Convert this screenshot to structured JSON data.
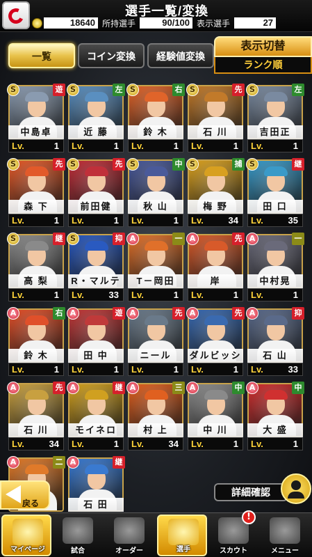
{
  "header": {
    "title": "選手一覧/変換",
    "coins": "18640",
    "owned_label": "所持選手",
    "owned_value": "90/100",
    "shown_label": "表示選手",
    "shown_value": "27"
  },
  "tabs": {
    "list": "一覧",
    "coin_convert": "コイン変換",
    "exp_convert": "経験値変換"
  },
  "sort": {
    "title": "表示切替",
    "value": "ランク順"
  },
  "players": [
    {
      "name": "中島卓",
      "lv": "1",
      "rank": "S",
      "pos": "遊",
      "pos_color": "red",
      "theme": "#8a9bb0"
    },
    {
      "name": "近 藤",
      "lv": "1",
      "rank": "S",
      "pos": "左",
      "pos_color": "green",
      "theme": "#5a8fc0"
    },
    {
      "name": "鈴 木",
      "lv": "1",
      "rank": "S",
      "pos": "右",
      "pos_color": "green",
      "theme": "#e0642a"
    },
    {
      "name": "石 川",
      "lv": "1",
      "rank": "S",
      "pos": "先",
      "pos_color": "red",
      "theme": "#c27a2a"
    },
    {
      "name": "吉田正",
      "lv": "1",
      "rank": "S",
      "pos": "左",
      "pos_color": "green",
      "theme": "#7a8aa0"
    },
    {
      "name": "森 下",
      "lv": "1",
      "rank": "S",
      "pos": "先",
      "pos_color": "red",
      "theme": "#e25a2a"
    },
    {
      "name": "前田健",
      "lv": "1",
      "rank": "S",
      "pos": "先",
      "pos_color": "red",
      "theme": "#c0303a"
    },
    {
      "name": "秋 山",
      "lv": "1",
      "rank": "S",
      "pos": "中",
      "pos_color": "green",
      "theme": "#4a5a9a"
    },
    {
      "name": "梅 野",
      "lv": "34",
      "rank": "S",
      "pos": "捕",
      "pos_color": "green",
      "theme": "#d8a020"
    },
    {
      "name": "田 口",
      "lv": "35",
      "rank": "S",
      "pos": "継",
      "pos_color": "red",
      "theme": "#3a9ac8"
    },
    {
      "name": "高 梨",
      "lv": "1",
      "rank": "S",
      "pos": "継",
      "pos_color": "red",
      "theme": "#8a8a8a"
    },
    {
      "name": "R・マルティネス",
      "lv": "33",
      "rank": "S",
      "pos": "抑",
      "pos_color": "red",
      "theme": "#2a5ac0"
    },
    {
      "name": "T－岡田",
      "lv": "1",
      "rank": "A",
      "pos": "一",
      "pos_color": "olive",
      "theme": "#e0702a"
    },
    {
      "name": "岸",
      "lv": "1",
      "rank": "A",
      "pos": "先",
      "pos_color": "red",
      "theme": "#d85a2a"
    },
    {
      "name": "中村晃",
      "lv": "1",
      "rank": "A",
      "pos": "一",
      "pos_color": "olive",
      "theme": "#6a6a7a"
    },
    {
      "name": "鈴 木",
      "lv": "1",
      "rank": "A",
      "pos": "右",
      "pos_color": "green",
      "theme": "#e0502a"
    },
    {
      "name": "田 中",
      "lv": "1",
      "rank": "A",
      "pos": "遊",
      "pos_color": "red",
      "theme": "#c03a3a"
    },
    {
      "name": "ニール",
      "lv": "1",
      "rank": "A",
      "pos": "先",
      "pos_color": "red",
      "theme": "#6a7a8a"
    },
    {
      "name": "ダルビッシュ",
      "lv": "1",
      "rank": "A",
      "pos": "先",
      "pos_color": "red",
      "theme": "#3a6ab0"
    },
    {
      "name": "石 山",
      "lv": "33",
      "rank": "A",
      "pos": "抑",
      "pos_color": "red",
      "theme": "#5a6a8a"
    },
    {
      "name": "石 川",
      "lv": "34",
      "rank": "A",
      "pos": "先",
      "pos_color": "red",
      "theme": "#c8a040"
    },
    {
      "name": "モイネロ",
      "lv": "1",
      "rank": "A",
      "pos": "継",
      "pos_color": "red",
      "theme": "#d0a020"
    },
    {
      "name": "村 上",
      "lv": "34",
      "rank": "A",
      "pos": "三",
      "pos_color": "olive",
      "theme": "#e06020"
    },
    {
      "name": "中 川",
      "lv": "1",
      "rank": "A",
      "pos": "中",
      "pos_color": "green",
      "theme": "#8a8a8a"
    },
    {
      "name": "大 盛",
      "lv": "1",
      "rank": "A",
      "pos": "中",
      "pos_color": "green",
      "theme": "#d03030"
    },
    {
      "name": "",
      "lv": "",
      "rank": "A",
      "pos": "二",
      "pos_color": "olive",
      "theme": "#e07a2a"
    },
    {
      "name": "石 田",
      "lv": "",
      "rank": "A",
      "pos": "継",
      "pos_color": "red",
      "theme": "#3a7ad0"
    }
  ],
  "lv_prefix": "Lv.",
  "buttons": {
    "back": "戻る",
    "detail": "詳細確認"
  },
  "nav": [
    {
      "label": "マイページ",
      "icon": "home-icon",
      "highlight": true
    },
    {
      "label": "試合",
      "icon": "stadium-icon",
      "highlight": false
    },
    {
      "label": "オーダー",
      "icon": "lineup-icon",
      "highlight": false
    },
    {
      "label": "選手",
      "icon": "player-icon",
      "highlight": true
    },
    {
      "label": "スカウト",
      "icon": "scout-icon",
      "highlight": false,
      "badge": "!"
    },
    {
      "label": "メニュー",
      "icon": "menu-icon",
      "highlight": false
    }
  ],
  "colors": {
    "gold": "#e0a418",
    "pos_red": "#d6202b",
    "pos_green": "#2e8b2e",
    "pos_olive": "#8b8b18"
  }
}
